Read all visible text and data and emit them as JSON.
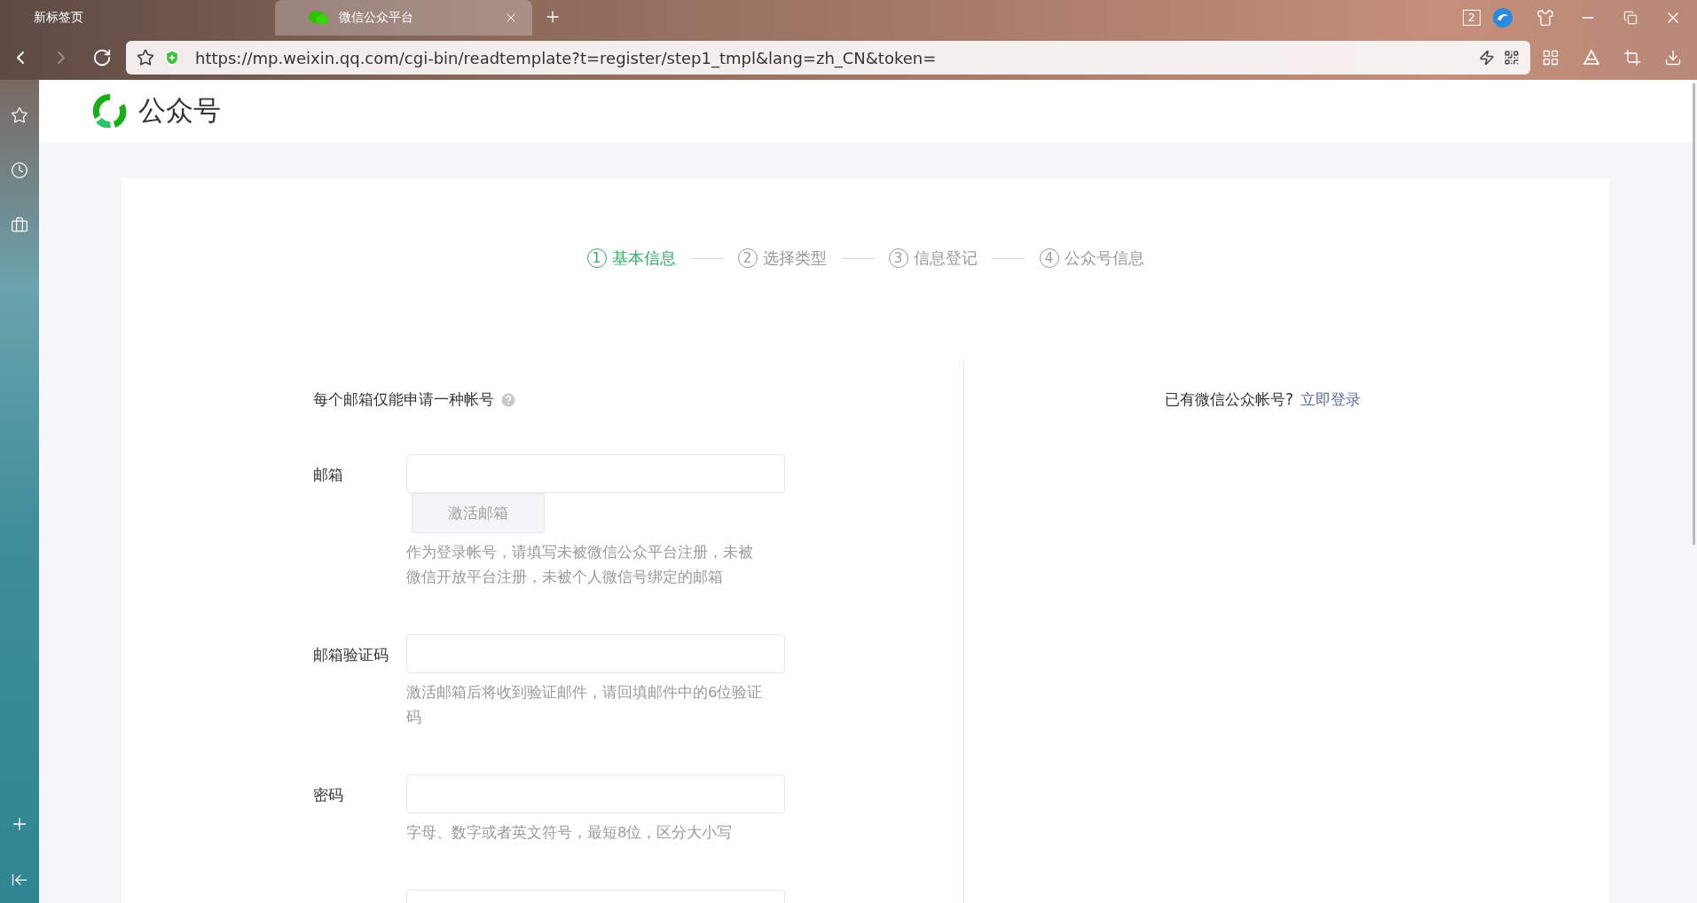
{
  "browser": {
    "tabs": [
      {
        "title": "新标签页",
        "selected": false,
        "kind": "plain"
      },
      {
        "title": "微信公众平台",
        "selected": true,
        "kind": "wechat"
      }
    ],
    "window_count": "2",
    "url": "https://mp.weixin.qq.com/cgi-bin/readtemplate?t=register/step1_tmpl&lang=zh_CN&token=",
    "back_disabled": false,
    "forward_disabled": true
  },
  "header": {
    "logo_text": "公众号"
  },
  "steps": [
    {
      "number": "1",
      "label": "基本信息",
      "selected": true
    },
    {
      "number": "2",
      "label": "选择类型",
      "selected": false
    },
    {
      "number": "3",
      "label": "信息登记",
      "selected": false
    },
    {
      "number": "4",
      "label": "公众号信息",
      "selected": false
    }
  ],
  "form": {
    "intro": "每个邮箱仅能申请一种帐号",
    "fields": [
      {
        "kind": "labeled",
        "label": "邮箱",
        "button": {
          "label": "激活邮箱",
          "disabled": true
        },
        "hint": "作为登录帐号，请填写未被微信公众平台注册，未被微信开放平台注册，未被个人微信号绑定的邮箱"
      },
      {
        "kind": "labeled",
        "label": "邮箱验证码",
        "hint": "激活邮箱后将收到验证邮件，请回填邮件中的6位验证码"
      },
      {
        "kind": "labeled",
        "label": "密码",
        "hint": "字母、数字或者英文符号，最短8位，区分大小写"
      },
      {
        "kind": "bare"
      }
    ]
  },
  "login": {
    "prompt": "已有微信公众帐号?",
    "link": "立即登录"
  }
}
